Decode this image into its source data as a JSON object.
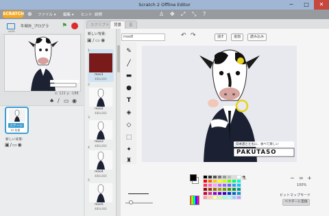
{
  "window": {
    "title": "Scratch 2 Offline Editor",
    "minimize": "─",
    "maximize": "□",
    "close": "✕"
  },
  "menubar": {
    "logo": "SCRATCH",
    "items": [
      {
        "label": "ファイル ▾"
      },
      {
        "label": "編集 ▾"
      },
      {
        "label": "ヒント"
      },
      {
        "label": "説明"
      }
    ],
    "toolbar_icons": [
      "person-icon",
      "stamp-icon",
      "grow-icon",
      "shrink-icon",
      "help-icon"
    ]
  },
  "stage": {
    "version": "v459",
    "project_title": "牛時計_プログラ",
    "green_flag": "⚑",
    "stop": "●",
    "coords": "x: 122  y: -188",
    "thumbnail_label": "ステージ",
    "thumbnail_sub": "10 背景",
    "new_backdrop": "新しい背景:"
  },
  "tabs": [
    {
      "label": "スクリプト"
    },
    {
      "label": "背景"
    },
    {
      "label": "音"
    }
  ],
  "costumes": {
    "new_label": "新しい背景:",
    "items": [
      {
        "num": "1",
        "name": "moo1",
        "dim": "480x360"
      },
      {
        "num": "2",
        "name": "moo2",
        "dim": "480x360"
      },
      {
        "num": "3",
        "name": "moo3",
        "dim": "480x360"
      },
      {
        "num": "4",
        "name": "moo4",
        "dim": "480x360"
      },
      {
        "num": "5",
        "name": "moo5",
        "dim": "480x360"
      }
    ]
  },
  "editor": {
    "costume_name": "moo8",
    "clear": "消す",
    "add": "追加",
    "import": "読み込み",
    "undo": "↶",
    "redo": "↷",
    "watermark_text": "日本語とともに、食べて楽しい",
    "watermark_brand": "PAKUTASO",
    "zoom_out": "−",
    "zoom_reset": "=",
    "zoom_in": "+",
    "zoom_level": "100%",
    "mode_label": "ビットマップモード",
    "vector_button": "ベクターに変換",
    "palette": [
      "#000000",
      "#333333",
      "#555555",
      "#777777",
      "#999999",
      "#bbbbbb",
      "#dddddd",
      "#ffffff",
      "#ff0000",
      "#ff6600",
      "#ffcc00",
      "#ffff00",
      "#ccff00",
      "#66ff00",
      "#00ff66",
      "#00ffcc",
      "#ff3366",
      "#ff66cc",
      "#ff99ff",
      "#cc66ff",
      "#9966ff",
      "#6666ff",
      "#3399ff",
      "#00ccff",
      "#990000",
      "#993300",
      "#996600",
      "#999900",
      "#669900",
      "#339900",
      "#009933",
      "#009999",
      "#cc0033",
      "#cc3399",
      "#9900cc",
      "#6600cc",
      "#3300cc",
      "#0033cc",
      "#0066cc",
      "#0099cc",
      "#ff9999",
      "#ffcc99",
      "#ffff99",
      "#ccff99",
      "#99ffcc",
      "#99ffff",
      "#99ccff",
      "#cc99ff"
    ]
  }
}
